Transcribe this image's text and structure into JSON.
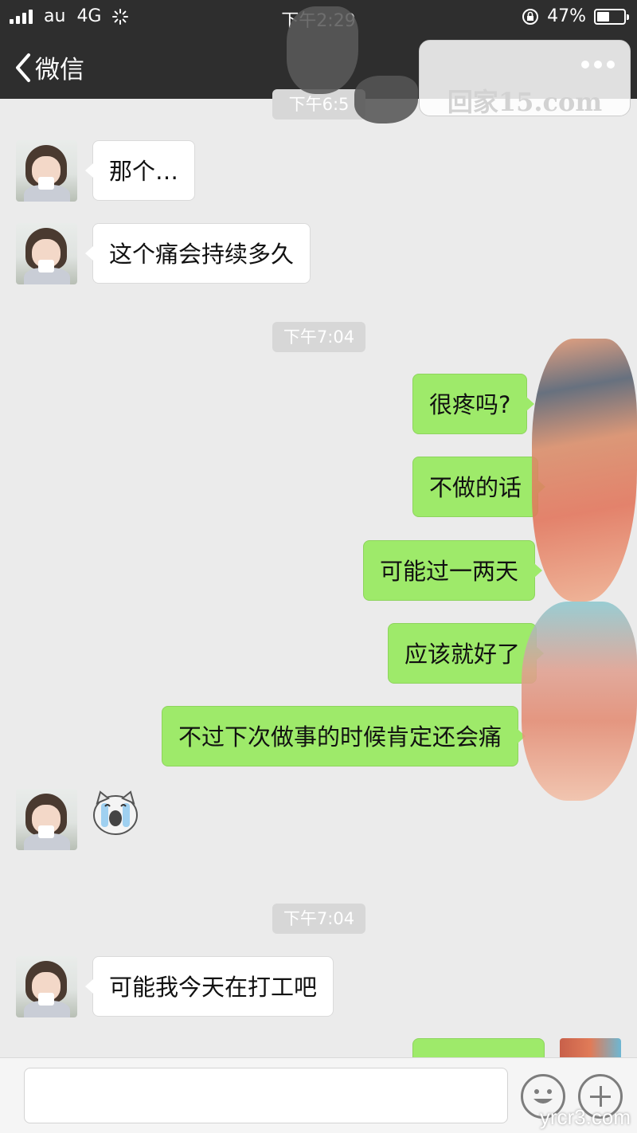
{
  "status_bar": {
    "carrier": "au",
    "network": "4G",
    "time": "下午2:29",
    "battery_percent": 47,
    "battery_label": "47%"
  },
  "nav_bar": {
    "back_label": "微信",
    "more_icon": "more-dots-icon"
  },
  "watermark": {
    "text": "回家15.com",
    "footer_text": "yrcr3.com"
  },
  "chat": {
    "timestamps": {
      "partial": "下午6:5",
      "first": "下午7:04",
      "second": "下午7:04"
    },
    "messages": [
      {
        "side": "incoming",
        "text": "那个…"
      },
      {
        "side": "incoming",
        "text": "这个痛会持续多久"
      },
      {
        "side": "outgoing",
        "text": "很疼吗?"
      },
      {
        "side": "outgoing",
        "text": "不做的话"
      },
      {
        "side": "outgoing",
        "text": "可能过一两天"
      },
      {
        "side": "outgoing",
        "text": "应该就好了"
      },
      {
        "side": "outgoing",
        "text": "不过下次做事的时候肯定还会痛"
      },
      {
        "side": "incoming",
        "sticker": "crying-cat-sticker"
      },
      {
        "side": "incoming",
        "text": "可能我今天在打工吧"
      },
      {
        "side": "outgoing",
        "text": ""
      }
    ]
  },
  "input_bar": {
    "value": "",
    "emoji_icon": "emoji-face-icon",
    "plus_icon": "plus-icon"
  },
  "colors": {
    "header_bg": "#2e2e2e",
    "chat_bg": "#ebebeb",
    "outgoing_bubble": "#9eea6a",
    "incoming_bubble": "#ffffff",
    "timestamp_bg": "#d7d7d7"
  }
}
